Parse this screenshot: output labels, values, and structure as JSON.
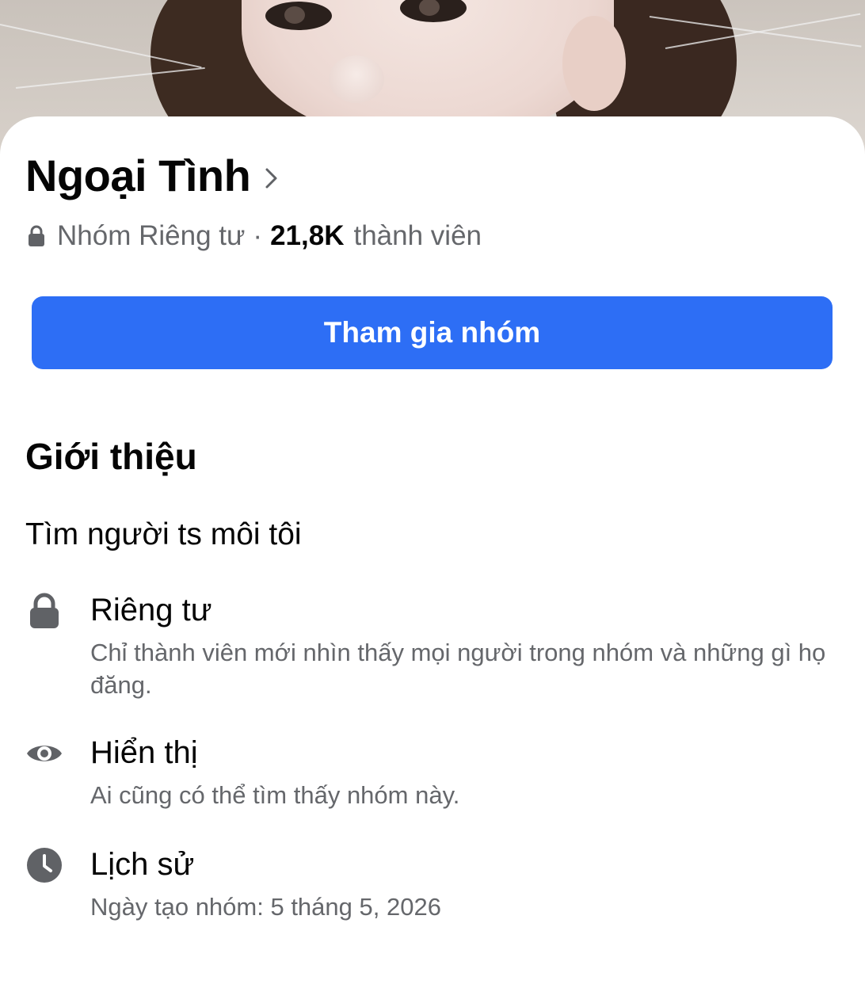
{
  "group": {
    "name": "Ngoại Tình",
    "privacy_label": "Nhóm Riêng tư",
    "separator": "·",
    "member_count": "21,8K",
    "member_label": "thành viên"
  },
  "actions": {
    "join_label": "Tham gia nhóm"
  },
  "about": {
    "title": "Giới thiệu",
    "description": "Tìm người ts môi tôi",
    "items": [
      {
        "icon": "lock-icon",
        "title": "Riêng tư",
        "subtitle": "Chỉ thành viên mới nhìn thấy mọi người trong nhóm và những gì họ đăng."
      },
      {
        "icon": "eye-icon",
        "title": "Hiển thị",
        "subtitle": "Ai cũng có thể tìm thấy nhóm này."
      },
      {
        "icon": "clock-icon",
        "title": "Lịch sử",
        "subtitle": "Ngày tạo nhóm: 5 tháng 5, 2026"
      }
    ]
  },
  "colors": {
    "primary_button": "#2d6ef5",
    "secondary_text": "#65676b",
    "icon_gray": "#606266"
  }
}
